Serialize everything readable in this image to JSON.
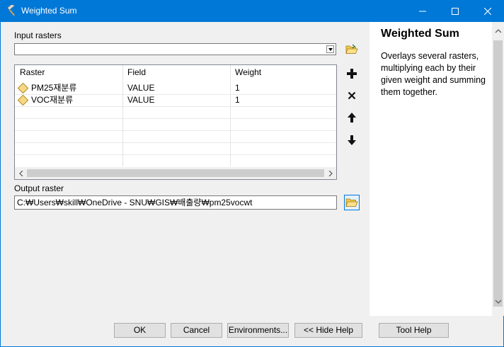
{
  "window": {
    "title": "Weighted Sum"
  },
  "input_rasters": {
    "label": "Input rasters",
    "value": ""
  },
  "table": {
    "columns": [
      "Raster",
      "Field",
      "Weight"
    ],
    "rows": [
      {
        "raster": "PM25재분류",
        "field": "VALUE",
        "weight": "1"
      },
      {
        "raster": "VOC재분류",
        "field": "VALUE",
        "weight": "1"
      }
    ]
  },
  "output_raster": {
    "label": "Output raster",
    "value": "C:₩Users₩skill₩OneDrive - SNU₩GIS₩배출량₩pm25vocwt"
  },
  "help_panel": {
    "title": "Weighted Sum",
    "body": "Overlays several rasters, multiplying each by their given weight and summing them together."
  },
  "buttons": {
    "ok": "OK",
    "cancel": "Cancel",
    "environments": "Environments...",
    "hide_help": "<< Hide Help",
    "tool_help": "Tool Help"
  },
  "colors": {
    "titlebar": "#0078d7",
    "help_bg": "#ffffff",
    "dialog_bg": "#f0f0f0"
  },
  "icons": [
    "hammer-icon",
    "minimize-icon",
    "maximize-icon",
    "close-icon",
    "folder-open-icon",
    "add-icon",
    "delete-icon",
    "move-up-icon",
    "move-down-icon",
    "raster-layer-icon"
  ]
}
